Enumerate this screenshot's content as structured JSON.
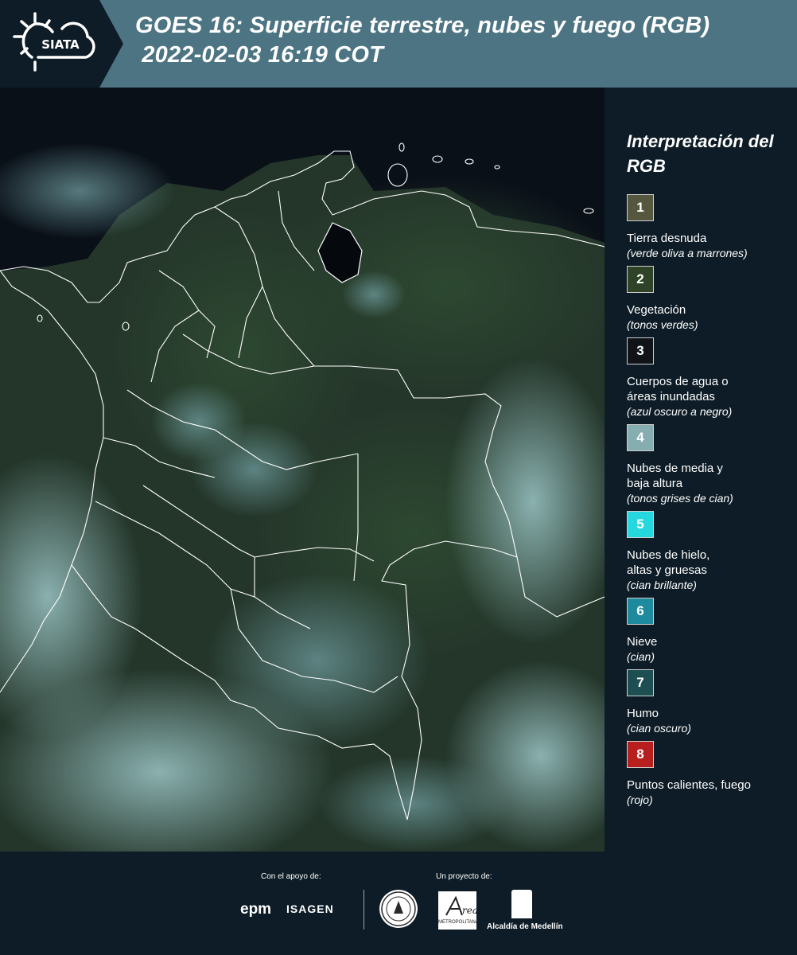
{
  "header": {
    "logo_text": "SIATA",
    "title_line1": "GOES 16: Superficie terrestre, nubes y fuego (RGB)",
    "title_line2": " 2022-02-03 16:19 COT"
  },
  "legend": {
    "title": "Interpretación del RGB",
    "items": [
      {
        "number": "1",
        "label": "Tierra desnuda",
        "desc": "(verde oliva a marrones)",
        "color": "#55583f"
      },
      {
        "number": "2",
        "label": "Vegetación",
        "desc": "(tonos verdes)",
        "color": "#2f4427"
      },
      {
        "number": "3",
        "label": "Cuerpos de agua o áreas inundadas",
        "desc": "(azul oscuro a negro)",
        "color": "#101418"
      },
      {
        "number": "4",
        "label": "Nubes de media y baja altura",
        "desc": "(tonos grises de cian)",
        "color": "#86aeb0"
      },
      {
        "number": "5",
        "label": "Nubes de hielo, altas y gruesas",
        "desc": "(cian brillante)",
        "color": "#25d8df"
      },
      {
        "number": "6",
        "label": "Nieve",
        "desc": "(cian)",
        "color": "#1e8a9d"
      },
      {
        "number": "7",
        "label": "Humo",
        "desc": "(cian oscuro)",
        "color": "#1d4f52"
      },
      {
        "number": "8",
        "label": "Puntos calientes, fuego",
        "desc": "(rojo)",
        "color": "#b71f1f"
      }
    ]
  },
  "footer": {
    "support_label": "Con el apoyo de:",
    "project_label": "Un proyecto de:",
    "epm": "epm",
    "isagen": "ISAGEN",
    "area_text": "METROPOLITANA",
    "alcaldia": "Alcaldía de Medellín"
  },
  "map": {
    "coastline_color": "#ffffff",
    "ocean_color": "#0a1018",
    "land_color": "#25352a",
    "cloud_color": "#8ab6b8"
  }
}
